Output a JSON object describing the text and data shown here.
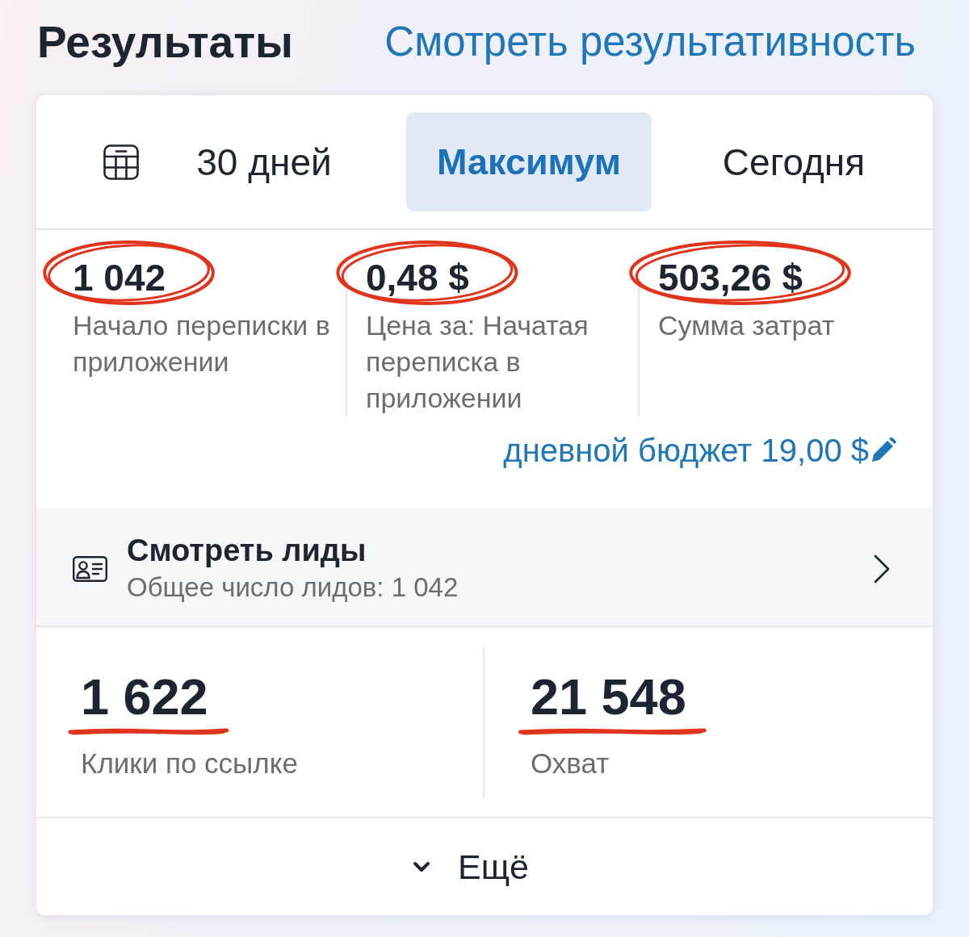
{
  "header": {
    "title": "Результаты",
    "link": "Смотреть результативность"
  },
  "period_tabs": [
    {
      "label": "30 дней",
      "selected": false
    },
    {
      "label": "Максимум",
      "selected": true
    },
    {
      "label": "Сегодня",
      "selected": false
    }
  ],
  "metrics": [
    {
      "value": "1 042",
      "label": "Начало переписки в приложении",
      "circled": true
    },
    {
      "value": "0,48 $",
      "label": "Цена за: Начатая переписка в приложении",
      "circled": true
    },
    {
      "value": "503,26 $",
      "label": "Сумма затрат",
      "circled": true
    }
  ],
  "daily_budget": {
    "label": "дневной бюджет 19,00 $"
  },
  "leads": {
    "title": "Смотреть лиды",
    "subtitle": "Общее число лидов: 1 042"
  },
  "stats": [
    {
      "value": "1 622",
      "label": "Клики по ссылке",
      "underlined": true
    },
    {
      "value": "21 548",
      "label": "Охват",
      "underlined": true
    }
  ],
  "more_button": {
    "label": "Ещё"
  }
}
